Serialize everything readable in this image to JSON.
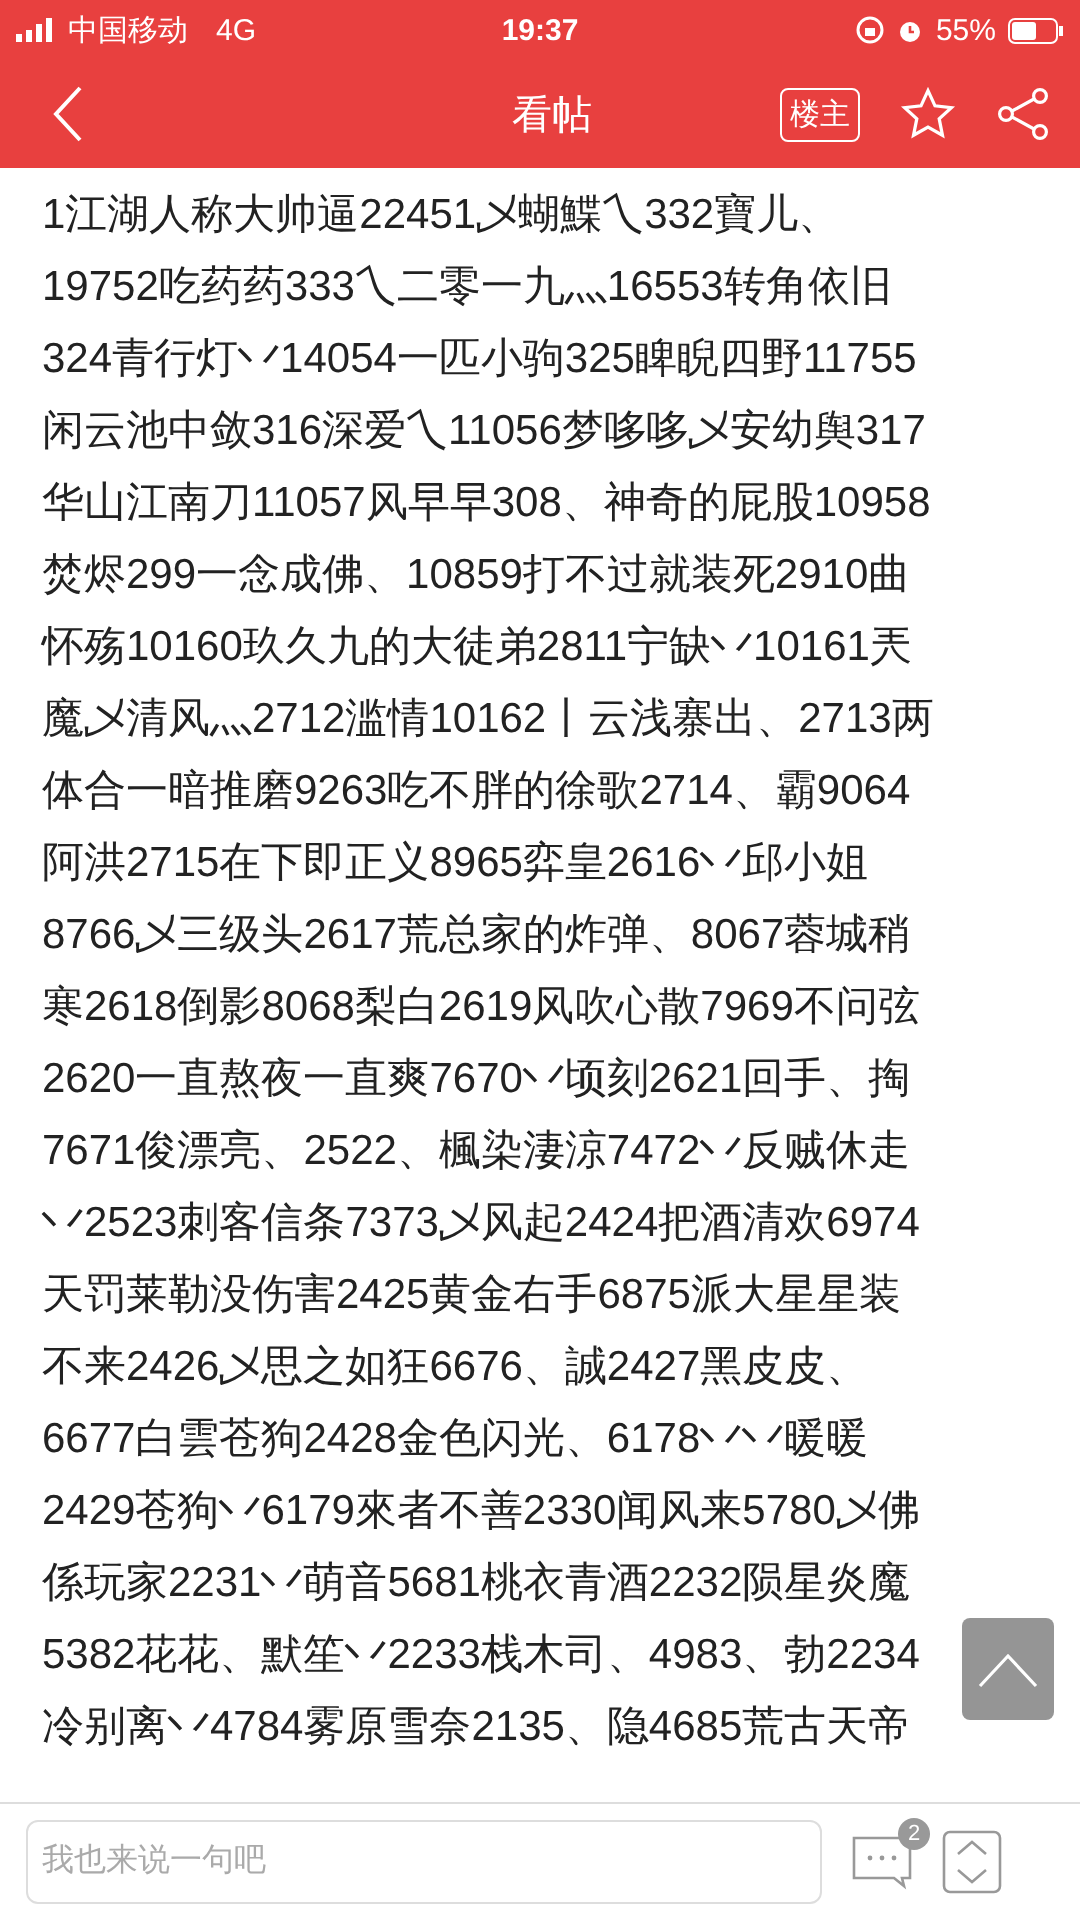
{
  "status_bar": {
    "carrier": "中国移动",
    "network": "4G",
    "time": "19:37",
    "battery": "55%"
  },
  "header": {
    "title": "看帖",
    "owner_button": "楼主",
    "favorited": false
  },
  "post": {
    "lines": [
      "1江湖人称大帅逼22451乄蝴鰈乀332寶儿、",
      "19752吃药药333乀二零一九灬16553转角依旧",
      "324青行灯丷14054一匹小驹325睥睨四野11755",
      "闲云池中敛316深爱乀11056梦哆哆乄安幼舆317",
      "华山江南刀11057风早早308、神奇的屁股10958",
      "焚烬299一念成佛、10859打不过就装死2910曲",
      "怀殇10160玖久九的大徒弟2811宁缺丷10161兲",
      "魔乄清风灬2712滥情10162丨云浅寨出、2713两",
      "体合一暗推磨9263吃不胖的徐歌2714、霸9064",
      "阿洪2715在下即正义8965弈皇2616丷邱小姐",
      "8766乄三级头2617荒总家的炸弹、8067蓉城稍",
      "寒2618倒影8068梨白2619风吹心散7969不问弦",
      "2620一直熬夜一直爽7670丷顷刻2621回手、掏",
      "7671俊漂亮、2522、楓染淒涼7472丷反贼休走",
      "丷2523刺客信条7373乄风起2424把酒清欢6974",
      "天罚莱勒没伤害2425黄金右手6875派大星星装",
      "不来2426乄思之如狂6676、誠2427黑皮皮、",
      "6677白雲苍狗2428金色闪光、6178丷丷暖暖",
      "2429苍狗丷6179來者不善2330闻风来5780乄佛",
      "係玩家2231丷萌音5681桃衣青酒2232陨星炎魔",
      "5382花花、默笙丷2233栈木司、4983、勃2234",
      "冷别离丷4784雾原雪奈2135、隐4685荒古天帝"
    ]
  },
  "reply_bar": {
    "placeholder": "我也来说一句吧",
    "comment_count": "2"
  }
}
